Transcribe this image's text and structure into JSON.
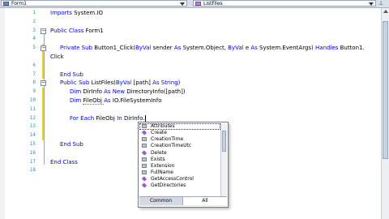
{
  "toolbar": {
    "class_combo": "Form1",
    "method_combo": "ListFiles"
  },
  "code_lines": [
    {
      "num": "1",
      "tokens": [
        {
          "t": "Imports ",
          "c": "kw"
        },
        {
          "t": "System.IO",
          "c": ""
        }
      ]
    },
    {
      "num": "2",
      "tokens": []
    },
    {
      "num": "3",
      "tokens": [
        {
          "t": "Public Class ",
          "c": "kw"
        },
        {
          "t": "Form1",
          "c": ""
        }
      ]
    },
    {
      "num": "4",
      "tokens": []
    },
    {
      "num": "5",
      "tokens": [
        {
          "t": "Private Sub ",
          "c": "kw"
        },
        {
          "t": "Button1_Click(",
          "c": ""
        },
        {
          "t": "ByVal ",
          "c": "kw"
        },
        {
          "t": "sender ",
          "c": ""
        },
        {
          "t": "As ",
          "c": "kw"
        },
        {
          "t": "System.Object, ",
          "c": ""
        },
        {
          "t": "ByVal ",
          "c": "kw"
        },
        {
          "t": "e ",
          "c": ""
        },
        {
          "t": "As ",
          "c": "kw"
        },
        {
          "t": "System.EventArgs) ",
          "c": ""
        },
        {
          "t": "Handles ",
          "c": "kw"
        },
        {
          "t": "Button1.",
          "c": ""
        }
      ]
    },
    {
      "num": "",
      "tokens": [
        {
          "t": "Click",
          "c": ""
        }
      ]
    },
    {
      "num": "6",
      "tokens": []
    },
    {
      "num": "7",
      "tokens": [
        {
          "t": "End Sub",
          "c": "kw"
        }
      ]
    },
    {
      "num": "8",
      "tokens": [
        {
          "t": "Public Sub ",
          "c": "kw"
        },
        {
          "t": "ListFiles(",
          "c": ""
        },
        {
          "t": "ByVal ",
          "c": "kw"
        },
        {
          "t": "[path] ",
          "c": ""
        },
        {
          "t": "As ",
          "c": "kw"
        },
        {
          "t": "String",
          "c": "kw"
        },
        {
          "t": ")",
          "c": ""
        }
      ]
    },
    {
      "num": "9",
      "tokens": [
        {
          "t": "Dim ",
          "c": "kw"
        },
        {
          "t": "DirInfo ",
          "c": ""
        },
        {
          "t": "As New ",
          "c": "kw"
        },
        {
          "t": "DirectoryInfo([path])",
          "c": ""
        }
      ]
    },
    {
      "num": "10",
      "tokens": [
        {
          "t": "Dim ",
          "c": "kw"
        },
        {
          "t": "FileObj ",
          "c": "sq"
        },
        {
          "t": "As ",
          "c": "kw"
        },
        {
          "t": "IO.FileSystemInfo",
          "c": ""
        }
      ]
    },
    {
      "num": "11",
      "tokens": []
    },
    {
      "num": "12",
      "tokens": [
        {
          "t": "For Each ",
          "c": "kw"
        },
        {
          "t": "FileObj ",
          "c": ""
        },
        {
          "t": "In ",
          "c": "kw"
        },
        {
          "t": "DirInfo.",
          "c": ""
        }
      ]
    },
    {
      "num": "13",
      "tokens": []
    },
    {
      "num": "14",
      "tokens": []
    },
    {
      "num": "15",
      "tokens": [
        {
          "t": "End Sub",
          "c": "kw"
        }
      ]
    },
    {
      "num": "16",
      "tokens": []
    },
    {
      "num": "17",
      "tokens": [
        {
          "t": "End Class",
          "c": "kw"
        }
      ]
    },
    {
      "num": "18",
      "tokens": []
    },
    {
      "num": "",
      "tokens": []
    },
    {
      "num": "",
      "tokens": []
    },
    {
      "num": "",
      "tokens": []
    },
    {
      "num": "",
      "tokens": []
    }
  ],
  "intellisense": {
    "items": [
      {
        "label": "Attributes",
        "kind": "prop",
        "selected": true
      },
      {
        "label": "Create",
        "kind": "method"
      },
      {
        "label": "CreationTime",
        "kind": "prop"
      },
      {
        "label": "CreationTimeUtc",
        "kind": "prop"
      },
      {
        "label": "Delete",
        "kind": "method"
      },
      {
        "label": "Exists",
        "kind": "prop"
      },
      {
        "label": "Extension",
        "kind": "prop"
      },
      {
        "label": "FullName",
        "kind": "prop"
      },
      {
        "label": "GetAccessControl",
        "kind": "method"
      },
      {
        "label": "GetDirectories",
        "kind": "method"
      }
    ],
    "tab_common": "Common",
    "tab_all": "All"
  },
  "colors": {
    "keyword": "#0000ff",
    "line_number": "#2b91af",
    "change_bar": "#f2d600"
  }
}
